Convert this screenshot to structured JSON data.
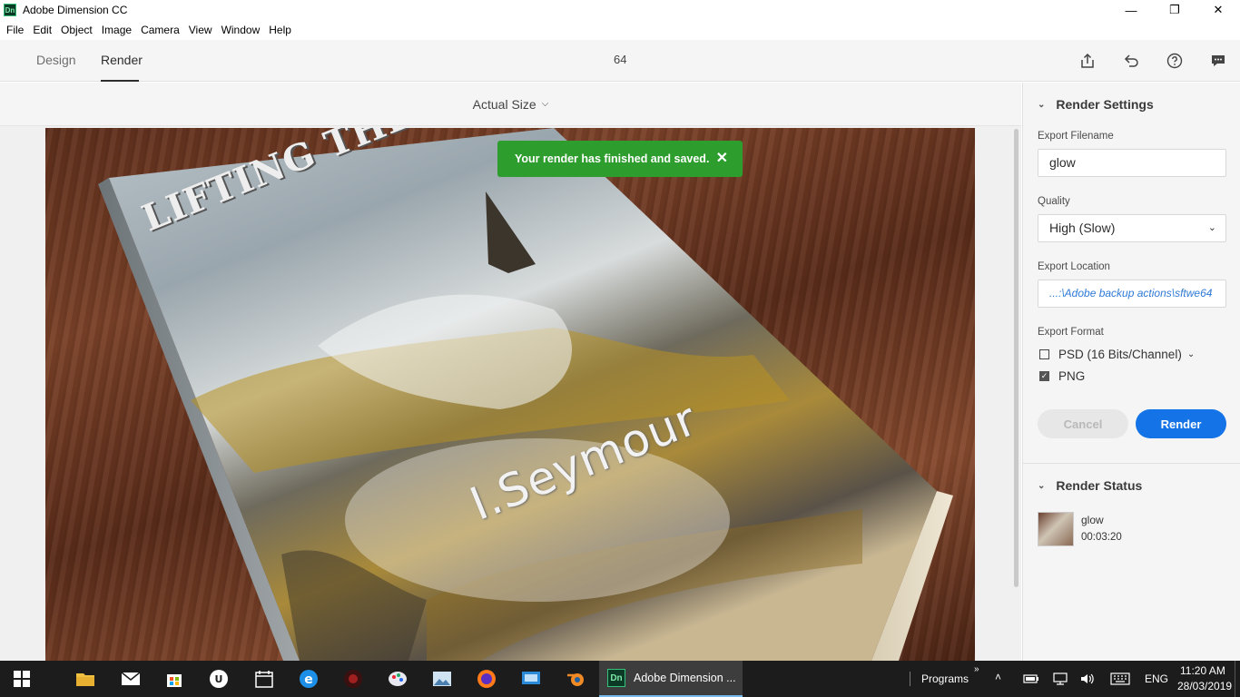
{
  "window": {
    "title": "Adobe Dimension CC",
    "logo_text": "Dn",
    "minimize_glyph": "—",
    "maximize_glyph": "❐",
    "close_glyph": "✕"
  },
  "menu": [
    "File",
    "Edit",
    "Object",
    "Image",
    "Camera",
    "View",
    "Window",
    "Help"
  ],
  "topnav": {
    "tabs": [
      {
        "label": "Design",
        "active": false
      },
      {
        "label": "Render",
        "active": true
      }
    ],
    "document_title": "64",
    "icons": [
      "share-icon",
      "undo-icon",
      "help-icon",
      "feedback-icon"
    ]
  },
  "canvas": {
    "zoom_label": "Actual Size",
    "render_title_text": "LIFTING THE MIST",
    "render_author_text": "I.Seymour"
  },
  "toast": {
    "message": "Your render has finished and saved.",
    "close_glyph": "✕"
  },
  "render_settings": {
    "header": "Render Settings",
    "filename_label": "Export Filename",
    "filename_value": "glow",
    "quality_label": "Quality",
    "quality_value": "High (Slow)",
    "location_label": "Export Location",
    "location_value": "...:\\Adobe backup actions\\sftwe64",
    "format_label": "Export Format",
    "formats": [
      {
        "label": "PSD (16 Bits/Channel)",
        "checked": false,
        "has_dropdown": true
      },
      {
        "label": "PNG",
        "checked": true,
        "has_dropdown": false
      }
    ],
    "cancel_label": "Cancel",
    "render_label": "Render"
  },
  "render_status": {
    "header": "Render Status",
    "items": [
      {
        "name": "glow",
        "time": "00:03:20"
      }
    ]
  },
  "taskbar": {
    "active_app_label": "Adobe Dimension ...",
    "active_app_logo": "Dn",
    "programs_label": "Programs",
    "language": "ENG",
    "time": "11:20 AM",
    "date": "28/03/2019"
  },
  "colors": {
    "accent": "#1473e6",
    "toast": "#2d9d2d",
    "taskbar": "#1c1c1c"
  }
}
